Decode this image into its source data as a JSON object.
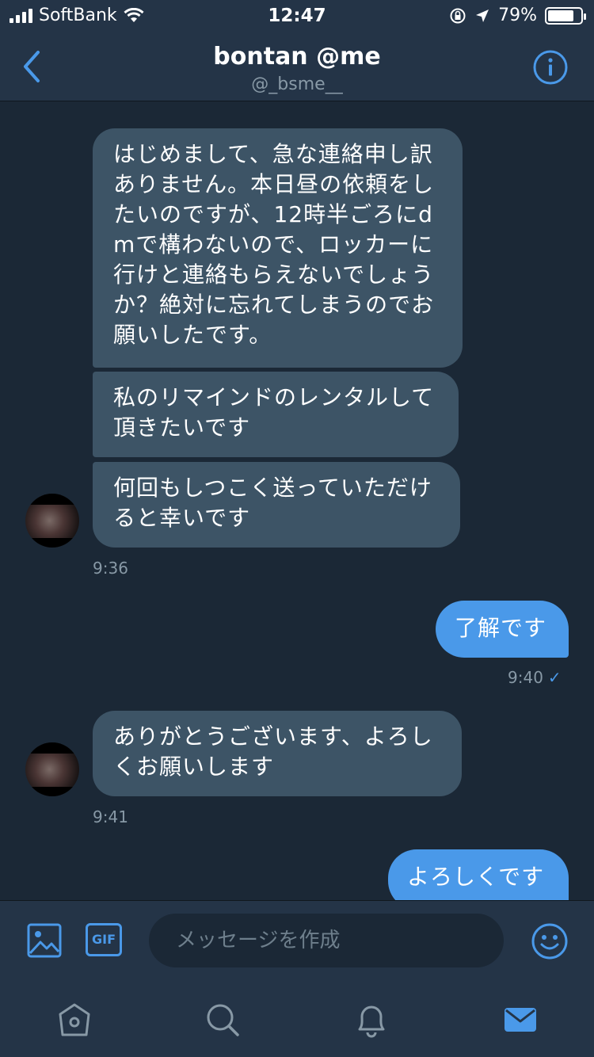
{
  "status_bar": {
    "carrier": "SoftBank",
    "time": "12:47",
    "battery_percent": "79%",
    "battery_level": 0.79
  },
  "header": {
    "title": "bontan @me",
    "subtitle": "@_bsme__"
  },
  "messages": [
    {
      "direction": "in",
      "text": "はじめまして、急な連絡申し訳ありません。本日昼の依頼をしたいのですが、12時半ごろにdmで構わないので、ロッカーに行けと連絡もらえないでしょうか？絶対に忘れてしまうのでお願いしたです。"
    },
    {
      "direction": "in",
      "text": "私のリマインドのレンタルして頂きたいです"
    },
    {
      "direction": "in",
      "text": "何回もしつこく送っていただけると幸いです"
    },
    {
      "direction": "out",
      "text": "了解です"
    },
    {
      "direction": "in",
      "text": "ありがとうございます、よろしくお願いします"
    },
    {
      "direction": "out",
      "text": "よろしくです"
    }
  ],
  "timestamps": [
    "9:36",
    "9:40",
    "9:41"
  ],
  "composer": {
    "placeholder": "メッセージを作成",
    "gif_label": "GIF"
  },
  "colors": {
    "background": "#1b2836",
    "bar": "#243447",
    "incoming_bubble": "#3d5466",
    "outgoing_bubble": "#4a99e9",
    "accent": "#4a99e9",
    "muted_text": "#8899a6"
  },
  "icons": [
    "back-arrow-icon",
    "info-icon",
    "photo-icon",
    "gif-icon",
    "emoji-icon",
    "home-icon",
    "search-icon",
    "notifications-icon",
    "messages-icon"
  ]
}
